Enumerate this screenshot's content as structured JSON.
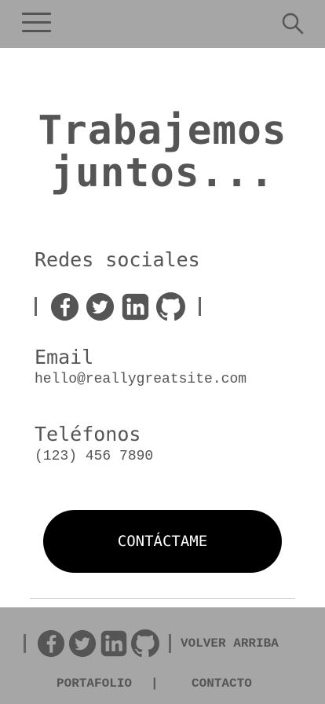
{
  "header": {
    "menu_icon": "hamburger-menu-icon",
    "search_icon": "search-icon"
  },
  "hero": {
    "title_line1": "Trabajemos",
    "title_line2": "juntos..."
  },
  "social": {
    "heading": "Redes sociales",
    "separator": "|",
    "icons": [
      "facebook-icon",
      "twitter-icon",
      "linkedin-icon",
      "github-icon"
    ]
  },
  "email": {
    "heading": "Email",
    "value": "hello@reallygreatsite.com"
  },
  "phone": {
    "heading": "Teléfonos",
    "value": "(123) 456 7890"
  },
  "cta": {
    "label": "CONTÁCTAME"
  },
  "footer": {
    "back_to_top": "VOLVER ARRIBA",
    "portfolio": "PORTAFOLIO",
    "separator": "|",
    "contact": "CONTACTO"
  },
  "colors": {
    "bar_bg": "#a6a6a6",
    "text": "#555555",
    "button_bg": "#000000",
    "button_text": "#ffffff"
  }
}
